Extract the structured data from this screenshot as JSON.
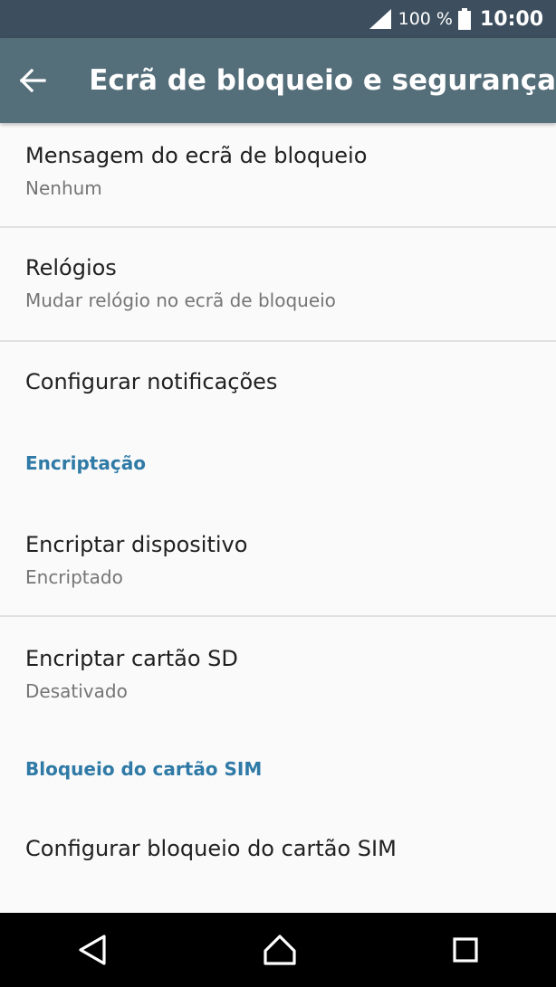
{
  "status_bar": {
    "battery_text": "100 %",
    "time": "10:00"
  },
  "app_bar": {
    "title": "Ecrã de bloqueio e segurança",
    "back_icon": "arrow-left-icon"
  },
  "items": [
    {
      "title": "Mensagem do ecrã de bloqueio",
      "summary": "Nenhum"
    },
    {
      "title": "Relógios",
      "summary": "Mudar relógio no ecrã de bloqueio"
    },
    {
      "title": "Configurar notificações"
    }
  ],
  "section_encryption": {
    "header": "Encriptação",
    "items": [
      {
        "title": "Encriptar dispositivo",
        "summary": "Encriptado"
      },
      {
        "title": "Encriptar cartão SD",
        "summary": "Desativado"
      }
    ]
  },
  "section_sim": {
    "header": "Bloqueio do cartão SIM",
    "items": [
      {
        "title": "Configurar bloqueio do cartão SIM"
      }
    ]
  },
  "nav_bar": {
    "back_icon": "triangle-back-icon",
    "home_icon": "home-icon",
    "recents_icon": "square-recents-icon"
  },
  "colors": {
    "status_bar": "#3d4e5e",
    "app_bar": "#546e7a",
    "accent": "#2f7aa6",
    "background": "#fafafa"
  }
}
